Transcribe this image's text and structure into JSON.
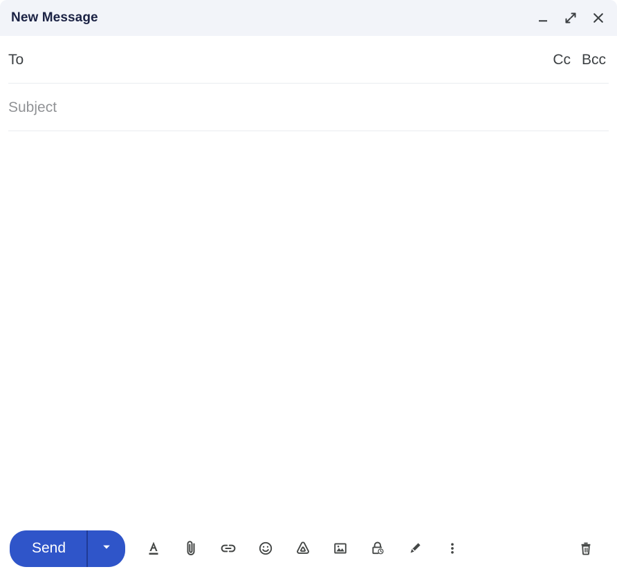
{
  "window": {
    "title": "New Message",
    "controls": [
      {
        "name": "minimize",
        "label": "Minimize"
      },
      {
        "name": "expand",
        "label": "Full screen"
      },
      {
        "name": "close",
        "label": "Save & close"
      }
    ]
  },
  "fields": {
    "to": {
      "label": "To",
      "value": "",
      "placeholder": "To"
    },
    "cc": {
      "label": "Cc"
    },
    "bcc": {
      "label": "Bcc"
    },
    "subject": {
      "label": "Subject",
      "value": "",
      "placeholder": "Subject"
    }
  },
  "body": {
    "value": "",
    "placeholder": ""
  },
  "toolbar": {
    "send_label": "Send",
    "send_options_label": "More send options",
    "icons": [
      {
        "name": "formatting-options-icon",
        "label": "Formatting options"
      },
      {
        "name": "attach-file-icon",
        "label": "Attach files"
      },
      {
        "name": "insert-link-icon",
        "label": "Insert link"
      },
      {
        "name": "insert-emoji-icon",
        "label": "Insert emoji"
      },
      {
        "name": "insert-drive-file-icon",
        "label": "Insert files using Drive"
      },
      {
        "name": "insert-photo-icon",
        "label": "Insert photo"
      },
      {
        "name": "confidential-mode-icon",
        "label": "Toggle confidential mode"
      },
      {
        "name": "insert-signature-icon",
        "label": "Insert signature"
      },
      {
        "name": "more-options-icon",
        "label": "More options"
      }
    ],
    "discard_label": "Discard draft"
  },
  "colors": {
    "header_bg": "#f2f4f9",
    "title_text": "#1b2244",
    "send_blue": "#2f55c9",
    "divider": "#e9ecef",
    "icon_gray": "#444746",
    "placeholder_gray": "#919396",
    "label_gray": "#3c4043"
  }
}
